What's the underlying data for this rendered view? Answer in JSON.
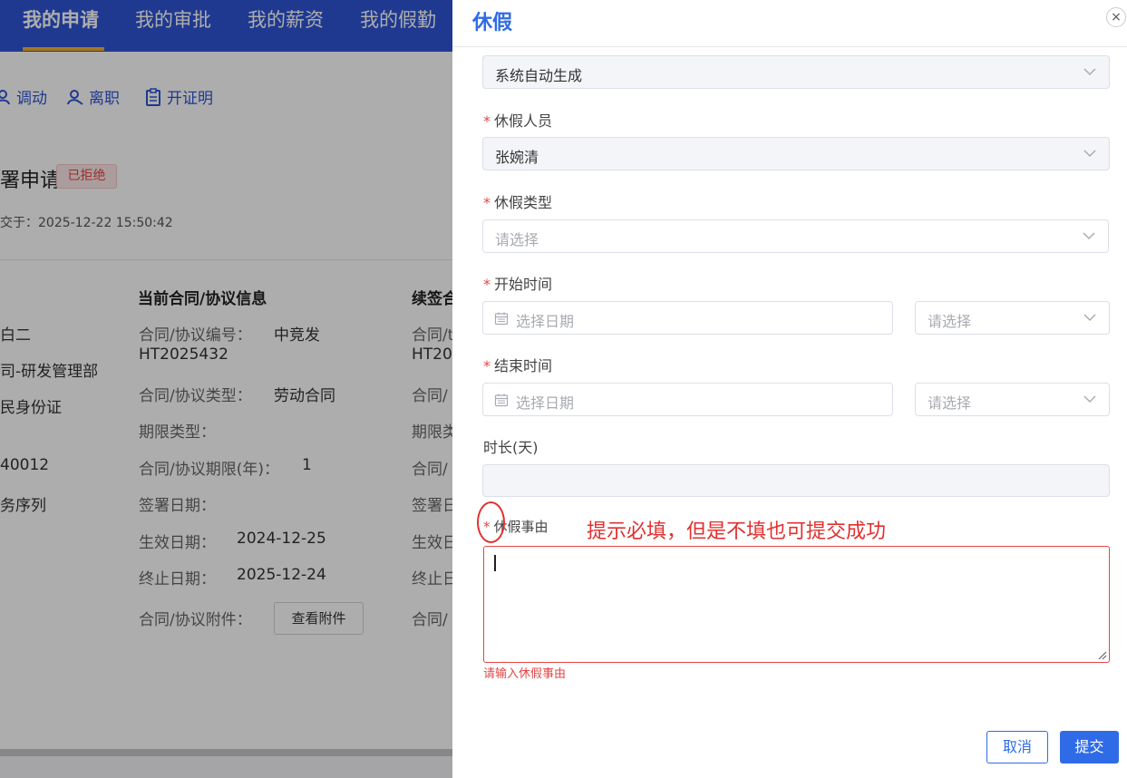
{
  "top_nav": {
    "tabs": [
      "我的申请",
      "我的审批",
      "我的薪资",
      "我的假勤"
    ],
    "active_index": 0
  },
  "toolbar": {
    "transfer_label": "调动",
    "resign_label": "离职",
    "certificate_label": "开证明"
  },
  "application": {
    "title": "署申请",
    "status_badge": "已拒绝",
    "submitted_at": "交于：2025-12-22 15:50:42",
    "left_values": [
      "白二",
      "司-研发管理部",
      "民身份证",
      "40012",
      "务序列"
    ],
    "current_contract": {
      "heading": "当前合同/协议信息",
      "number_label": "合同/协议编号：",
      "number_value_1": "中竞发",
      "number_value_2": "HT2025432",
      "type_label": "合同/协议类型：",
      "type_value": "劳动合同",
      "term_type_label": "期限类型：",
      "term_years_label": "合同/协议期限(年)：",
      "term_years_value": "1",
      "sign_date_label": "签署日期：",
      "effective_label": "生效日期：",
      "effective_value": "2024-12-25",
      "end_label": "终止日期：",
      "end_value": "2025-12-24",
      "attachment_label": "合同/协议附件：",
      "attachment_button": "查看附件"
    },
    "renewal_contract": {
      "heading": "续签合",
      "partial_labels": [
        "合同/t",
        "HT20",
        "合同/",
        "期限类",
        "合同/",
        "签署日",
        "生效日",
        "终止日",
        "合同/"
      ]
    }
  },
  "drawer": {
    "title": "休假",
    "close_icon": "×",
    "code_field": {
      "value": "系统自动生成"
    },
    "person_field": {
      "label": "休假人员",
      "value": "张婉清"
    },
    "type_field": {
      "label": "休假类型",
      "placeholder": "请选择"
    },
    "start_field": {
      "label": "开始时间",
      "date_placeholder": "选择日期",
      "period_placeholder": "请选择"
    },
    "end_field": {
      "label": "结束时间",
      "date_placeholder": "选择日期",
      "period_placeholder": "请选择"
    },
    "duration_field": {
      "label": "时长(天)",
      "value": ""
    },
    "reason_field": {
      "label": "休假事由",
      "value": "",
      "error": "请输入休假事由"
    },
    "annotation": "提示必填，但是不填也可提交成功",
    "cancel_label": "取消",
    "submit_label": "提交"
  },
  "colors": {
    "nav_blue": "#2f55d4",
    "primary": "#2f6be6",
    "error": "#e64545",
    "annotation_red": "#e03030"
  }
}
